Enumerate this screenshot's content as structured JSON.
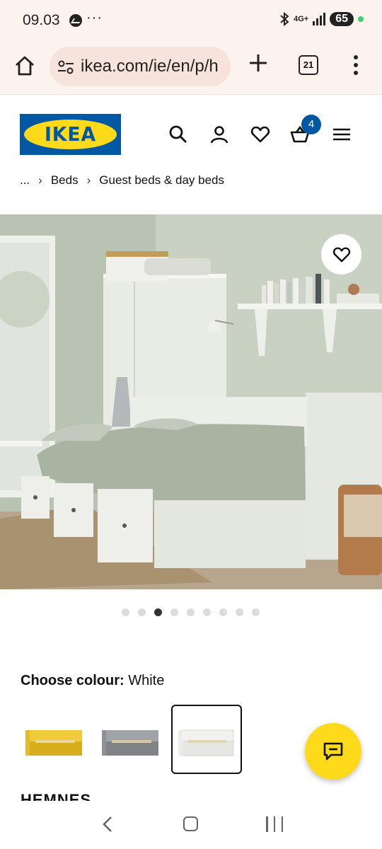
{
  "status_bar": {
    "time": "09.03",
    "dots": "···",
    "network": "4G+",
    "battery": "65",
    "icons": [
      "messenger-icon",
      "bluetooth-icon",
      "signal-icon",
      "battery-icon"
    ]
  },
  "browser": {
    "url": "ikea.com/ie/en/p/h",
    "tab_count": "21",
    "icons": [
      "home-icon",
      "site-settings-icon",
      "new-tab-icon",
      "tabs-icon",
      "menu-icon"
    ]
  },
  "header": {
    "logo_text": "IKEA",
    "cart_count": "4",
    "icons": [
      "search-icon",
      "account-icon",
      "heart-icon",
      "cart-icon",
      "hamburger-icon"
    ]
  },
  "breadcrumb": {
    "ellipsis": "...",
    "items": [
      "Beds",
      "Guest beds & day beds"
    ]
  },
  "gallery": {
    "image_count": 9,
    "active_index": 2
  },
  "colour": {
    "label": "Choose colour:",
    "selected": "White",
    "options": [
      {
        "name": "yellow",
        "color": "#e3bd2e"
      },
      {
        "name": "grey",
        "color": "#8e9296"
      },
      {
        "name": "white",
        "color": "#f1f1ee"
      }
    ]
  },
  "product": {
    "name": "HEMNES"
  },
  "colors": {
    "ikea_blue": "#0058a3",
    "ikea_yellow": "#ffda1a",
    "browser_bg": "#fdf3ee"
  }
}
